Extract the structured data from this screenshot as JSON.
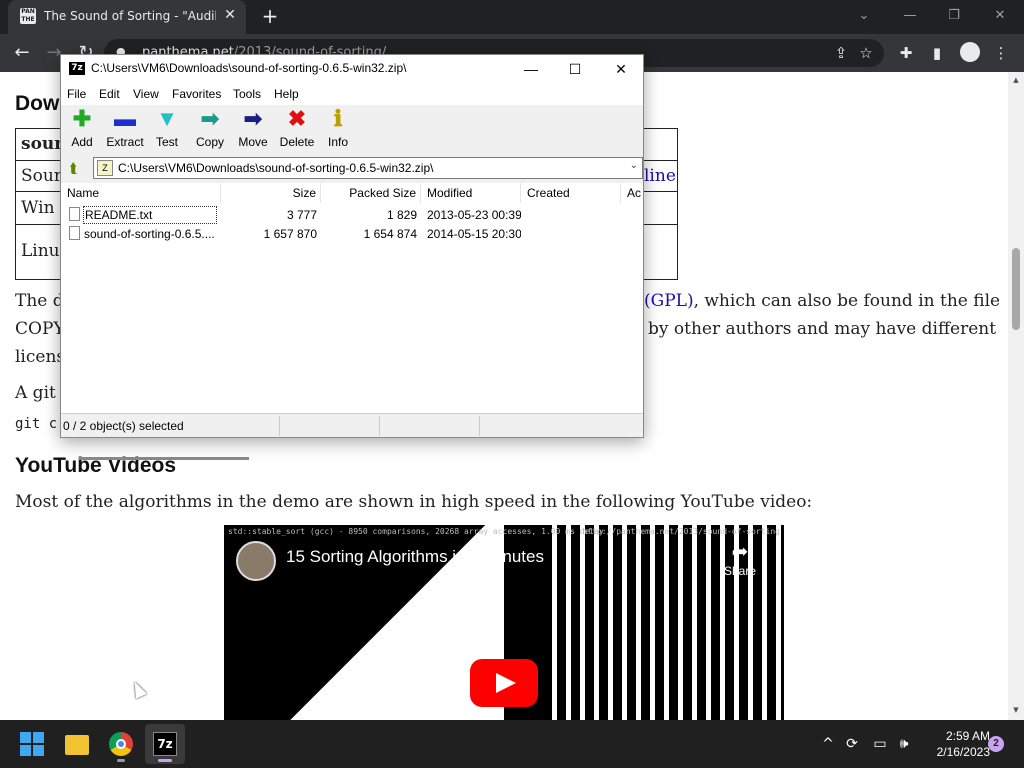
{
  "browser": {
    "tab": {
      "favicon_text": "PAN THE",
      "title": "The Sound of Sorting - \"Audibiliz",
      "close": "✕"
    },
    "new_tab": "+",
    "window_controls": {
      "minimize": "—",
      "restore": "❐",
      "close": "✕"
    },
    "chevron": "⌄",
    "nav": {
      "back": "←",
      "forward": "→",
      "reload": "↻"
    },
    "url_host": "panthema.net",
    "url_path": "/2013/sound-of-sorting/",
    "toolbar_icons": {
      "share": "⇪",
      "bookmark": "☆",
      "extensions": "✚",
      "sidepanel": "▮",
      "menu": "⋮"
    }
  },
  "page": {
    "download_heading": "Dow",
    "table": {
      "header_cell": "soun",
      "rows": [
        "Sour",
        "Win",
        "Linu"
      ],
      "link_right": "line"
    },
    "para1_left": "The d",
    "para1_right_link": "(GPL)",
    "para1_right": ", which can also be found in the file",
    "para2_left": "COPY",
    "para2_right": "by other authors and may have different",
    "para3_left": "licens",
    "git_line": "A git",
    "git_cmd": "git c",
    "youtube_heading": "YouTube Videos",
    "youtube_text": "Most of the algorithms in the demo are shown in high speed in the following YouTube video:",
    "video": {
      "caption_left": "std::stable_sort (gcc) - 8950 comparisons, 20268 array accesses, 1.00 ms delay",
      "caption_right": "http://panthema.net/2013/sound-of-sorting",
      "title": "15 Sorting Algorithms in 6 Minutes",
      "share_label": "Share",
      "share_icon": "➦"
    }
  },
  "sevenzip": {
    "app_icon_text": "7z",
    "title": "C:\\Users\\VM6\\Downloads\\sound-of-sorting-0.6.5-win32.zip\\",
    "controls": {
      "minimize": "—",
      "maximize": "☐",
      "close": "✕"
    },
    "menu": [
      "File",
      "Edit",
      "View",
      "Favorites",
      "Tools",
      "Help"
    ],
    "tools": [
      {
        "label": "Add",
        "icon": "✚",
        "color": "#22aa22"
      },
      {
        "label": "Extract",
        "icon": "▬",
        "color": "#1a2fd0"
      },
      {
        "label": "Test",
        "icon": "▼",
        "color": "#22c0c0"
      },
      {
        "label": "Copy",
        "icon": "➡",
        "color": "#1a9a8a"
      },
      {
        "label": "Move",
        "icon": "➡",
        "color": "#1a2080"
      },
      {
        "label": "Delete",
        "icon": "✖",
        "color": "#dd1111"
      },
      {
        "label": "Info",
        "icon": "ℹ",
        "color": "#b8a000"
      }
    ],
    "up_icon": "⮬",
    "path": "C:\\Users\\VM6\\Downloads\\sound-of-sorting-0.6.5-win32.zip\\",
    "path_dropdown": "⌄",
    "columns": [
      "Name",
      "Size",
      "Packed Size",
      "Modified",
      "Created",
      "Ac"
    ],
    "files": [
      {
        "name": "README.txt",
        "size": "3 777",
        "packed": "1 829",
        "modified": "2013-05-23 00:39"
      },
      {
        "name": "sound-of-sorting-0.6.5....",
        "size": "1 657 870",
        "packed": "1 654 874",
        "modified": "2014-05-15 20:30"
      }
    ],
    "status": "0 / 2 object(s) selected"
  },
  "taskbar": {
    "tray": {
      "chevron": "^",
      "sync": "⟳",
      "display": "▭",
      "volume": "🕪"
    },
    "time": "2:59 AM",
    "date": "2/16/2023",
    "notifications": "2"
  },
  "scroll_arrows": {
    "up": "▲",
    "down": "▼"
  }
}
